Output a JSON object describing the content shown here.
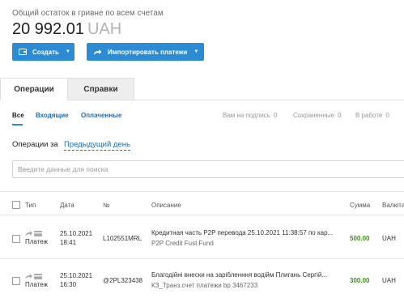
{
  "header": {
    "balance_label": "Общий остаток в гривне по всем счетам",
    "balance_amount": "20 992.01",
    "balance_currency": "UAH"
  },
  "toolbar": {
    "create_label": "Создать",
    "import_label": "Импортировать платежи"
  },
  "tabs": [
    {
      "label": "Операции",
      "active": true
    },
    {
      "label": "Справки",
      "active": false
    }
  ],
  "filters": {
    "left": [
      {
        "label": "Все",
        "active": true
      },
      {
        "label": "Входящие"
      },
      {
        "label": "Оплаченные"
      }
    ],
    "right": [
      {
        "label": "Вам на подпись",
        "count": "0"
      },
      {
        "label": "Сохраненные",
        "count": "0"
      },
      {
        "label": "В работе",
        "count": "0"
      }
    ]
  },
  "period": {
    "label": "Операции за",
    "value": "Предыдущий день"
  },
  "search": {
    "placeholder": "Введите данные для поиска"
  },
  "table": {
    "columns": [
      "Тип",
      "Дата",
      "№",
      "Описание",
      "Сумма",
      "Валюта"
    ],
    "rows": [
      {
        "type": "Платеж",
        "date": "25.10.2021",
        "time": "18:41",
        "number": "L102551MRL",
        "desc_line1": "Кредитная часть P2P перевода 25.10.2021 11:38:57 по кар...",
        "desc_line2": "P2P Credit Fust Fund",
        "sum": "500.00",
        "currency": "UAH"
      },
      {
        "type": "Платеж",
        "date": "25.10.2021",
        "time": "16:30",
        "number": "@2PL323438",
        "desc_line1": "Благодійні внески на зарібленння водійм Плигань Сергій...",
        "desc_line2": "КЗ_Транз.счет платежи bp 3467233",
        "sum": "300.00",
        "currency": "UAH"
      }
    ]
  },
  "colors": {
    "accent": "#2b8bd3",
    "link": "#1f6fae",
    "sum_green": "#3e8e1c"
  }
}
